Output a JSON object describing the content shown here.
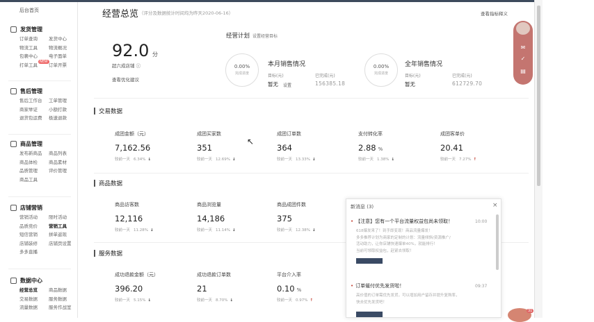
{
  "sidebar": {
    "home": "后台首页",
    "sections": [
      {
        "title": "发货管理",
        "rows": [
          [
            "订单查询",
            "发货中心"
          ],
          [
            "物流工具",
            "物流概况"
          ],
          [
            "包裹中心",
            "电子面单"
          ],
          [
            "打单工具",
            "订单开票"
          ]
        ]
      },
      {
        "title": "售后管理",
        "rows": [
          [
            "售后工作台",
            "工单管理"
          ],
          [
            "商家举证",
            "小额打款"
          ],
          [
            "退货包运费",
            "极速退款"
          ]
        ]
      },
      {
        "title": "商品管理",
        "rows": [
          [
            "发布新商品",
            "商品列表"
          ],
          [
            "商品体检",
            "商品素材"
          ],
          [
            "品质管理",
            "评价管理"
          ],
          [
            "商品工具",
            ""
          ]
        ]
      },
      {
        "title": "店铺营销",
        "rows": [
          [
            "营销活动",
            "限时活动"
          ],
          [
            "品质竞价",
            "营销工具"
          ],
          [
            "短信营销",
            "拼单返现"
          ],
          [
            "店铺装修",
            "店铺页设置"
          ],
          [
            "多多直播",
            ""
          ]
        ]
      },
      {
        "title": "数据中心",
        "rows": [
          [
            "经营总览",
            "商品数据"
          ],
          [
            "交易数据",
            "服务数据"
          ],
          [
            "流量数据",
            "服务作战室"
          ]
        ]
      }
    ],
    "badge": "NEW"
  },
  "header": {
    "title": "经营总览",
    "subtitle": "（评分及数据统计时间均为昨天2020-06-16）",
    "link": "查看指标释义"
  },
  "score": {
    "value": "92.0",
    "unit": "分",
    "rank": "超六成店铺",
    "link": "查看优化建议"
  },
  "plan": {
    "title": "经营计划",
    "link": "设置经营目标",
    "month": {
      "title": "本月销售情况",
      "pct": "0.00%",
      "pct_label": "完成进度",
      "target_label": "目标(元)",
      "target": "暂无",
      "set": "设置",
      "done_label": "已完成(元)",
      "done": "156385.18"
    },
    "year": {
      "title": "全年销售情况",
      "pct": "0.00%",
      "pct_label": "完成进度",
      "target_label": "目标(元)",
      "target": "暂无",
      "done_label": "已完成(元)",
      "done": "612729.70"
    }
  },
  "sections": {
    "trade": {
      "title": "交易数据",
      "cmp_label": "较前一天",
      "metrics": [
        {
          "label": "成团金额（元）",
          "value": "7,162.56",
          "unit": "",
          "change": "6.34%",
          "dir": "down"
        },
        {
          "label": "成团买家数",
          "value": "351",
          "unit": "",
          "change": "12.69%",
          "dir": "down"
        },
        {
          "label": "成团订单数",
          "value": "364",
          "unit": "",
          "change": "13.33%",
          "dir": "down"
        },
        {
          "label": "支付转化率",
          "value": "2.88",
          "unit": "%",
          "change": "1.38%",
          "dir": "down"
        },
        {
          "label": "成团客单价",
          "value": "20.41",
          "unit": "",
          "change": "7.27%",
          "dir": "up"
        }
      ]
    },
    "goods": {
      "title": "商品数据",
      "cmp_label": "较前一天",
      "metrics": [
        {
          "label": "商品访客数",
          "value": "12,116",
          "unit": "",
          "change": "11.28%",
          "dir": "down"
        },
        {
          "label": "商品浏览量",
          "value": "14,186",
          "unit": "",
          "change": "11.14%",
          "dir": "down"
        },
        {
          "label": "商品成团件数",
          "value": "375",
          "unit": "",
          "change": "12.38%",
          "dir": "down"
        }
      ]
    },
    "service": {
      "title": "服务数据",
      "cmp_label": "较前一天",
      "metrics": [
        {
          "label": "成功退款金额（元）",
          "value": "396.20",
          "unit": "",
          "change": "5.15%",
          "dir": "down"
        },
        {
          "label": "成功退款订单数",
          "value": "21",
          "unit": "",
          "change": "8.70%",
          "dir": "down"
        },
        {
          "label": "平台介入率",
          "value": "0.10",
          "unit": "%",
          "change": "0.97%",
          "dir": "up"
        }
      ]
    }
  },
  "popup": {
    "header": "新消息 (3)",
    "close": "×",
    "messages": [
      {
        "title": "【注意】您有一个平台流量权益包尚未领取！",
        "time": "10:00",
        "body": [
          "618爆发来了！到手即变现！商品流量爆发！",
          "多多推荐计划为商家的定制的计划：流量倾斜/资源推广/",
          "活动助力，让你店铺快速爆单40%，就能排行！",
          "当前可领取权益包，赶紧去领取！"
        ]
      },
      {
        "title": "订单催付优先发货啦！",
        "time": "09:37",
        "body": [
          "高价值的订单需优先发货，可以增加用户留存并提升复购率，",
          "快去优先发货吧！"
        ]
      }
    ]
  },
  "chat_badge": "31",
  "colors": {
    "accent": "#3a4a64",
    "robot": "#c47570",
    "up": "#c0392b"
  }
}
